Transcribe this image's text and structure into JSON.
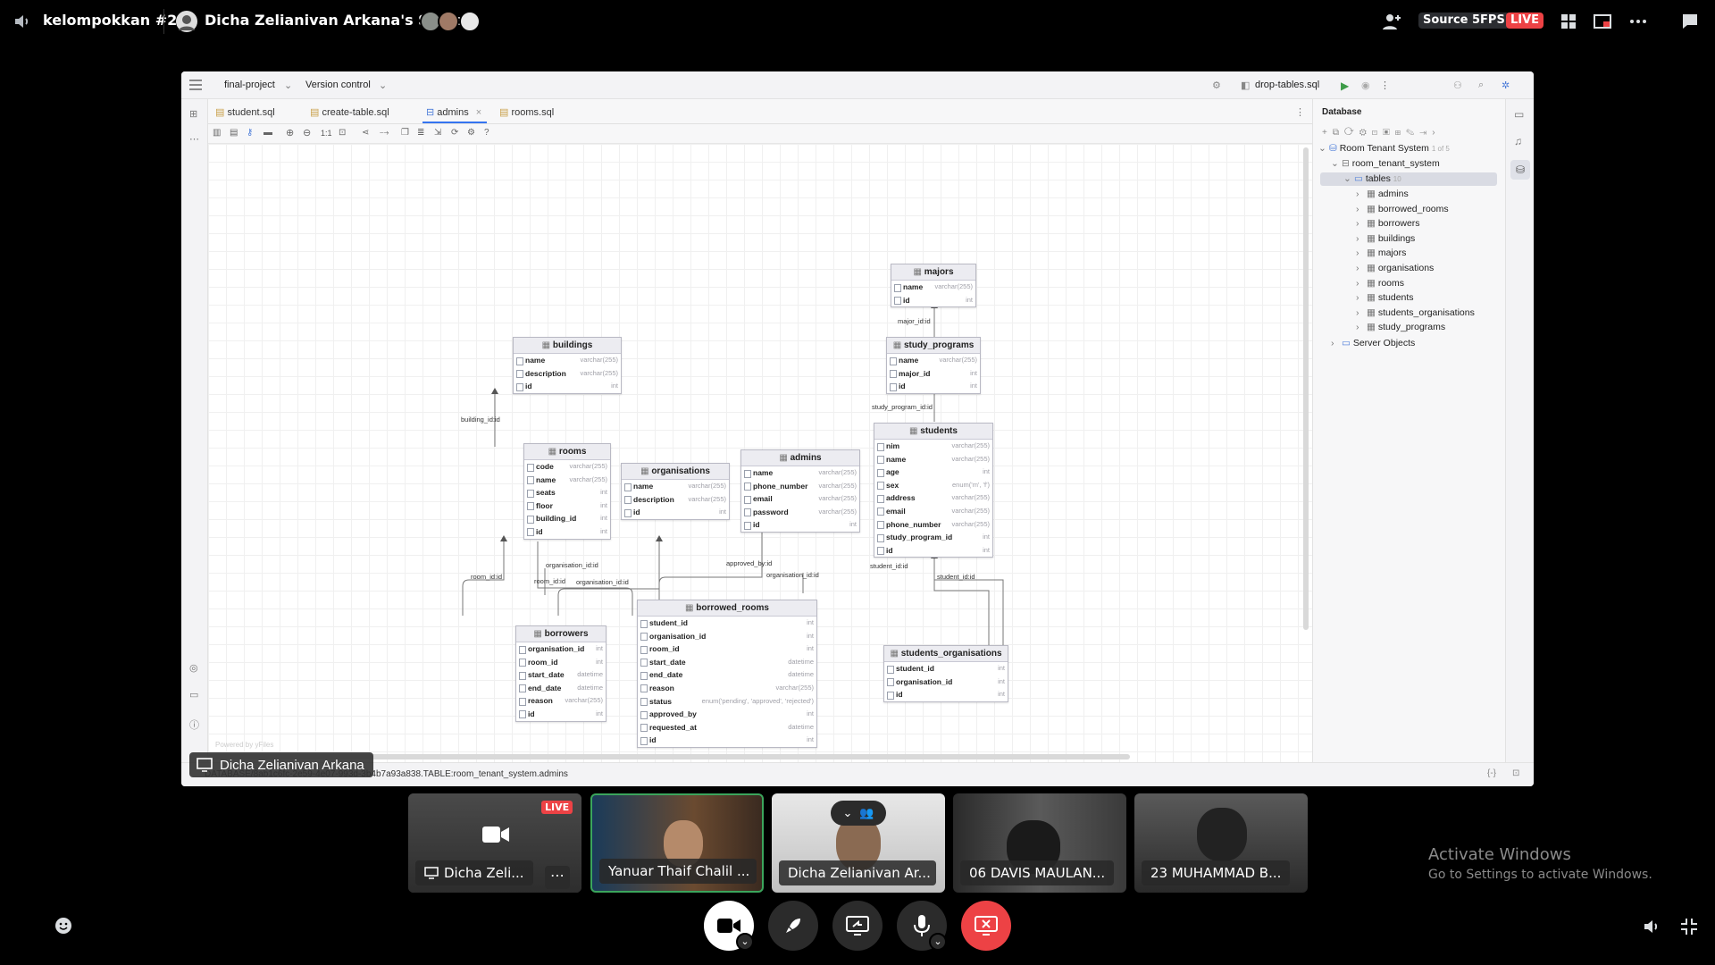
{
  "topbar": {
    "channel": "kelompokkan #2",
    "screen_title": "Dicha Zelianivan Arkana's Screen",
    "source_label": "Source 5FPS",
    "live_label": "LIVE"
  },
  "ide": {
    "project": "final-project",
    "vcs": "Version control",
    "run_config": "drop-tables.sql",
    "tabs": [
      "student.sql",
      "create-table.sql",
      "admins",
      "rooms.sql"
    ],
    "zoom": "1:1",
    "status_path": "DATABASE/8ab1c6fc-2e59-4e07-993d-3b4b7a93a838.TABLE:room_tenant_system.admins",
    "powered_by": "Powered by yFiles"
  },
  "db_panel": {
    "title": "Database",
    "root": "Room Tenant System",
    "root_badge": "1 of 5",
    "schema": "room_tenant_system",
    "folder": "tables",
    "folder_count": "10",
    "tables": [
      "admins",
      "borrowed_rooms",
      "borrowers",
      "buildings",
      "majors",
      "organisations",
      "rooms",
      "students",
      "students_organisations",
      "study_programs"
    ],
    "server_objects": "Server Objects"
  },
  "diagram": {
    "majors": {
      "title": "majors",
      "rows": [
        [
          "name",
          "varchar(255)"
        ],
        [
          "id",
          "int"
        ]
      ]
    },
    "study_programs": {
      "title": "study_programs",
      "rows": [
        [
          "name",
          "varchar(255)"
        ],
        [
          "major_id",
          "int"
        ],
        [
          "id",
          "int"
        ]
      ]
    },
    "buildings": {
      "title": "buildings",
      "rows": [
        [
          "name",
          "varchar(255)"
        ],
        [
          "description",
          "varchar(255)"
        ],
        [
          "id",
          "int"
        ]
      ]
    },
    "students": {
      "title": "students",
      "rows": [
        [
          "nim",
          "varchar(255)"
        ],
        [
          "name",
          "varchar(255)"
        ],
        [
          "age",
          "int"
        ],
        [
          "sex",
          "enum('m', 'f')"
        ],
        [
          "address",
          "varchar(255)"
        ],
        [
          "email",
          "varchar(255)"
        ],
        [
          "phone_number",
          "varchar(255)"
        ],
        [
          "study_program_id",
          "int"
        ],
        [
          "id",
          "int"
        ]
      ]
    },
    "rooms": {
      "title": "rooms",
      "rows": [
        [
          "code",
          "varchar(255)"
        ],
        [
          "name",
          "varchar(255)"
        ],
        [
          "seats",
          "int"
        ],
        [
          "floor",
          "int"
        ],
        [
          "building_id",
          "int"
        ],
        [
          "id",
          "int"
        ]
      ]
    },
    "organisations": {
      "title": "organisations",
      "rows": [
        [
          "name",
          "varchar(255)"
        ],
        [
          "description",
          "varchar(255)"
        ],
        [
          "id",
          "int"
        ]
      ]
    },
    "admins": {
      "title": "admins",
      "rows": [
        [
          "name",
          "varchar(255)"
        ],
        [
          "phone_number",
          "varchar(255)"
        ],
        [
          "email",
          "varchar(255)"
        ],
        [
          "password",
          "varchar(255)"
        ],
        [
          "id",
          "int"
        ]
      ]
    },
    "borrowed_rooms": {
      "title": "borrowed_rooms",
      "rows": [
        [
          "student_id",
          "int"
        ],
        [
          "organisation_id",
          "int"
        ],
        [
          "room_id",
          "int"
        ],
        [
          "start_date",
          "datetime"
        ],
        [
          "end_date",
          "datetime"
        ],
        [
          "reason",
          "varchar(255)"
        ],
        [
          "status",
          "enum('pending', 'approved', 'rejected')"
        ],
        [
          "approved_by",
          "int"
        ],
        [
          "requested_at",
          "datetime"
        ],
        [
          "id",
          "int"
        ]
      ]
    },
    "borrowers": {
      "title": "borrowers",
      "rows": [
        [
          "organisation_id",
          "int"
        ],
        [
          "room_id",
          "int"
        ],
        [
          "start_date",
          "datetime"
        ],
        [
          "end_date",
          "datetime"
        ],
        [
          "reason",
          "varchar(255)"
        ],
        [
          "id",
          "int"
        ]
      ]
    },
    "students_organisations": {
      "title": "students_organisations",
      "rows": [
        [
          "student_id",
          "int"
        ],
        [
          "organisation_id",
          "int"
        ],
        [
          "id",
          "int"
        ]
      ]
    },
    "labels": {
      "major": "major_id:id",
      "study_program": "study_program_id:id",
      "building": "building_id:id",
      "room1": "room_id:id",
      "room2": "room_id:id",
      "org1": "organisation_id:id",
      "org2": "organisation_id:id",
      "org3": "organisation_id:id",
      "approved": "approved_by:id",
      "student1": "student_id:id",
      "student2": "student_id:id"
    }
  },
  "presenter_label": "Dicha Zelianivan Arkana",
  "participants": [
    {
      "name": "Dicha Zeli...",
      "live": "LIVE"
    },
    {
      "name": "Yanuar Thaif Chalil ..."
    },
    {
      "name": "Dicha Zelianivan Ar..."
    },
    {
      "name": "06 DAVIS MAULAN..."
    },
    {
      "name": "23 MUHAMMAD B..."
    }
  ],
  "watermark": {
    "title": "Activate Windows",
    "subtitle": "Go to Settings to activate Windows."
  },
  "colors": {
    "live": "#ed4245",
    "active_speaker": "#3ba55c",
    "end_call": "#ed4245",
    "selection": "#d9dbe3"
  }
}
